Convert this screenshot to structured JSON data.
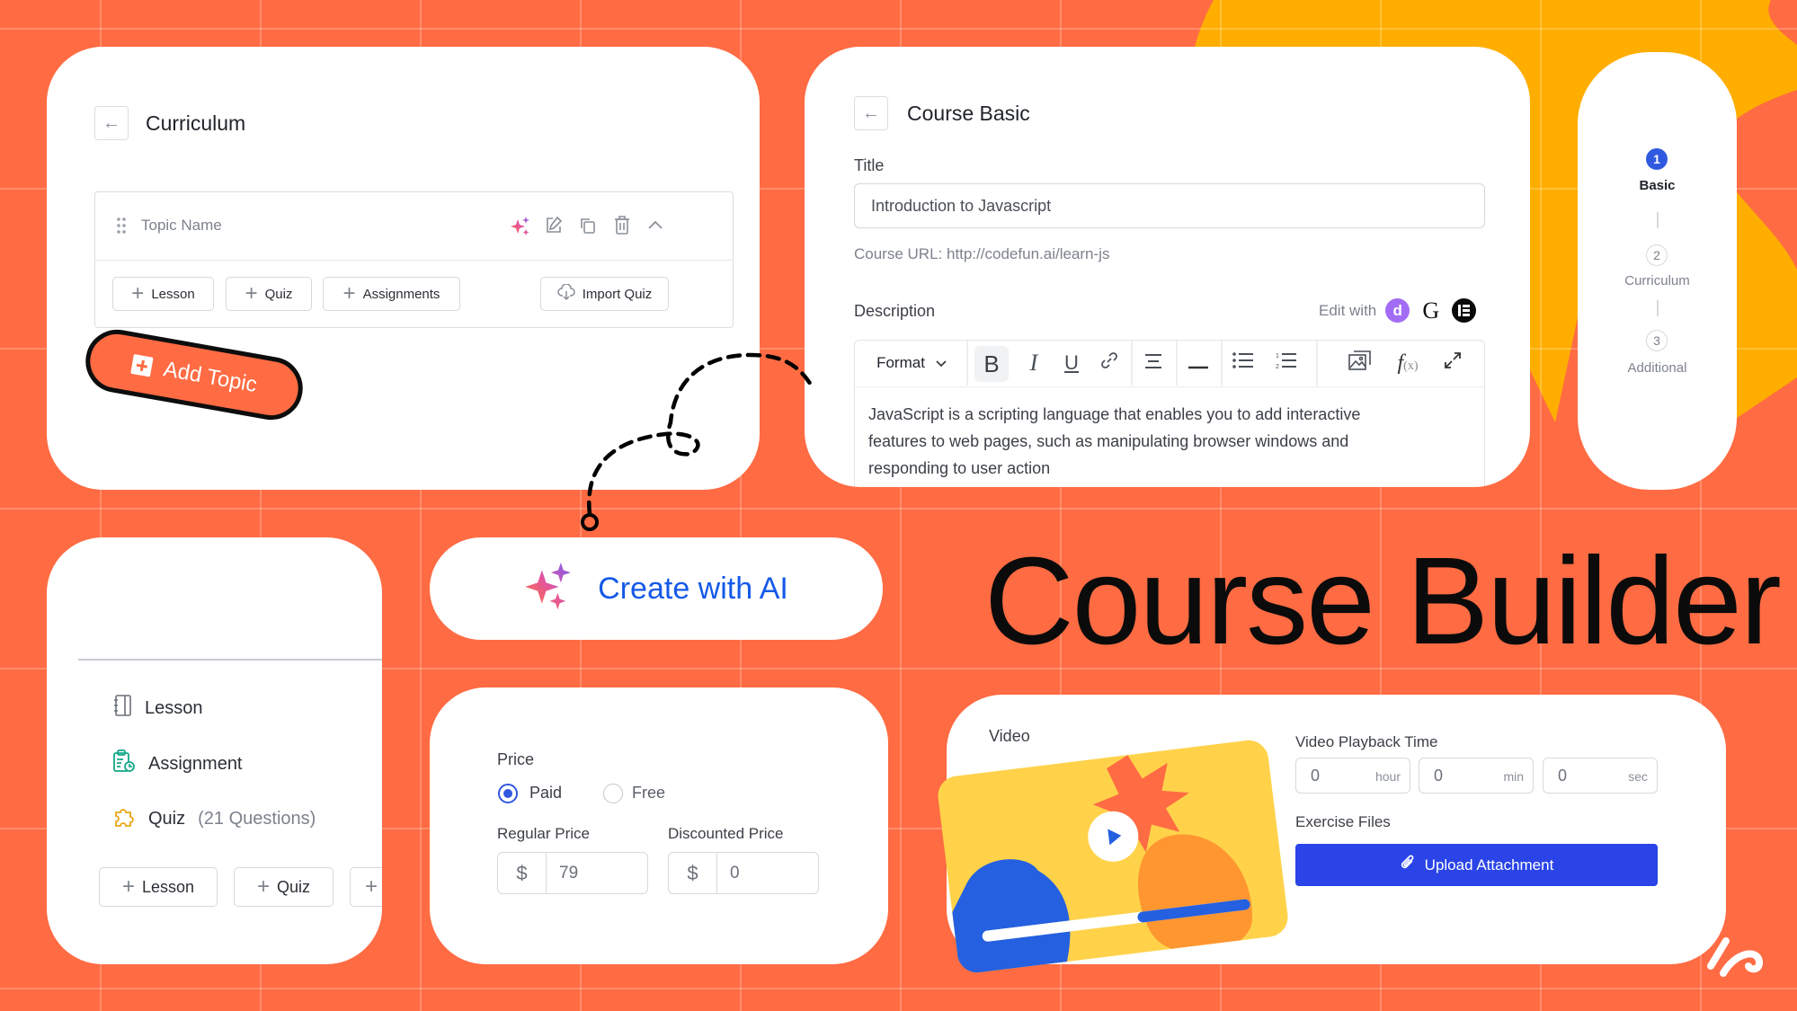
{
  "page": {
    "headline": "Course Builder",
    "colors": {
      "background": "#ff6b43",
      "accent_yellow": "#ffae00",
      "primary_blue": "#2a44e8",
      "ai_text_blue": "#1559e8",
      "card": "#ffffff"
    }
  },
  "curriculum": {
    "back_icon": "arrow-left-icon",
    "title": "Curriculum",
    "topic": {
      "name_placeholder": "Topic Name",
      "icons": [
        "drag-handle-icon",
        "ai-sparkle-icon",
        "edit-icon",
        "duplicate-icon",
        "delete-icon",
        "chevron-up-icon"
      ],
      "buttons": [
        {
          "icon": "plus-icon",
          "label": "Lesson"
        },
        {
          "icon": "plus-icon",
          "label": "Quiz"
        },
        {
          "icon": "plus-icon",
          "label": "Assignments"
        }
      ],
      "import_button": {
        "icon": "cloud-upload-icon",
        "label": "Import Quiz"
      }
    },
    "add_topic": {
      "icon": "plus-square-icon",
      "label": "Add Topic"
    }
  },
  "course_basic": {
    "back_icon": "arrow-left-icon",
    "title": "Course Basic",
    "title_label": "Title",
    "title_value": "Introduction to Javascript",
    "course_url_label": "Course URL:",
    "course_url": "http://codefun.ai/learn-js",
    "description_label": "Description",
    "edit_with_label": "Edit with",
    "edit_with_icons": [
      "divi-icon",
      "gutenberg-icon",
      "elementor-icon"
    ],
    "toolbar": {
      "format_label": "Format",
      "buttons": [
        "bold",
        "italic",
        "underline",
        "link",
        "align",
        "horizontal-rule",
        "bullet-list",
        "numbered-list",
        "image",
        "formula",
        "fullscreen"
      ]
    },
    "description_text": "JavaScript is a scripting language that enables you to add interactive features to web pages, such as manipulating browser windows and responding to user action"
  },
  "stepper": {
    "steps": [
      {
        "number": "1",
        "label": "Basic",
        "state": "active"
      },
      {
        "number": "2",
        "label": "Curriculum",
        "state": "inactive"
      },
      {
        "number": "3",
        "label": "Additional",
        "state": "inactive"
      }
    ]
  },
  "content_list": {
    "items": [
      {
        "icon": "lesson-notebook-icon",
        "label": "Lesson",
        "meta": ""
      },
      {
        "icon": "assignment-clipboard-icon",
        "label": "Assignment",
        "meta": ""
      },
      {
        "icon": "quiz-puzzle-icon",
        "label": "Quiz",
        "meta": "(21 Questions)"
      }
    ],
    "buttons": [
      {
        "icon": "plus-icon",
        "label": "Lesson"
      },
      {
        "icon": "plus-icon",
        "label": "Quiz"
      },
      {
        "icon": "plus-icon",
        "label": ""
      }
    ]
  },
  "ai_button": {
    "icon": "ai-sparkle-icon",
    "label": "Create with AI"
  },
  "price": {
    "label": "Price",
    "options": [
      {
        "label": "Paid",
        "selected": true
      },
      {
        "label": "Free",
        "selected": false
      }
    ],
    "regular_label": "Regular Price",
    "regular_currency": "$",
    "regular_value": "79",
    "discount_label": "Discounted Price",
    "discount_currency": "$",
    "discount_value": "0"
  },
  "video": {
    "label": "Video",
    "progress_fraction": 0.58,
    "playback_label": "Video Playback Time",
    "time_fields": [
      {
        "value": "0",
        "unit": "hour"
      },
      {
        "value": "0",
        "unit": "min"
      },
      {
        "value": "0",
        "unit": "sec"
      }
    ],
    "exercise_label": "Exercise Files",
    "upload_button": {
      "icon": "paperclip-icon",
      "label": "Upload Attachment"
    }
  }
}
